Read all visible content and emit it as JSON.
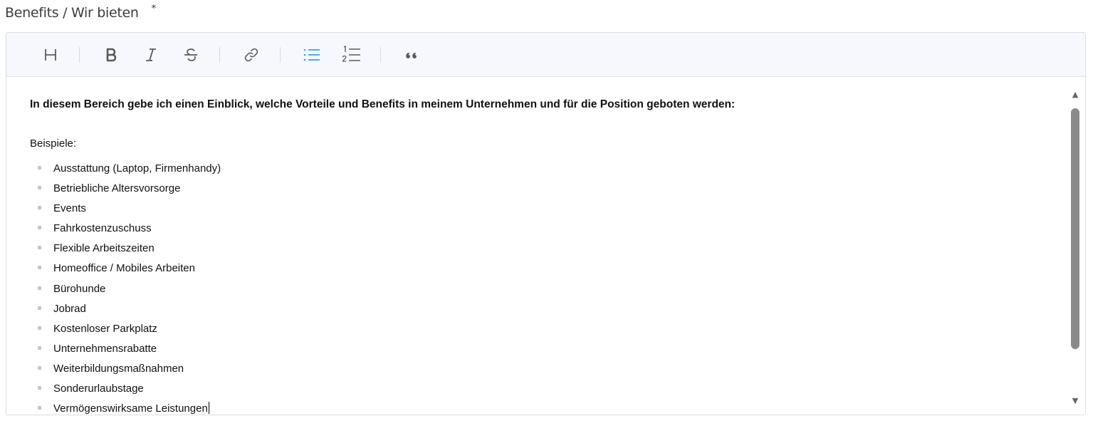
{
  "field": {
    "label": "Benefits / Wir bieten",
    "required_marker": "*"
  },
  "toolbar": {
    "buttons": [
      {
        "name": "heading",
        "icon": "heading-icon"
      },
      {
        "name": "bold",
        "icon": "bold-icon"
      },
      {
        "name": "italic",
        "icon": "italic-icon"
      },
      {
        "name": "strikethrough",
        "icon": "strikethrough-icon"
      },
      {
        "name": "link",
        "icon": "link-icon"
      },
      {
        "name": "bullet-list",
        "icon": "bullet-list-icon",
        "active": true
      },
      {
        "name": "numbered-list",
        "icon": "numbered-list-icon"
      },
      {
        "name": "quote",
        "icon": "quote-icon"
      }
    ],
    "active_color": "#2ea6e6"
  },
  "editor": {
    "intro": "In diesem Bereich gebe ich einen Einblick, welche Vorteile und Benefits in meinem Unternehmen und für die Position geboten werden:",
    "examples_label": "Beispiele:",
    "items": [
      "Ausstattung (Laptop, Firmenhandy)",
      "Betriebliche Altersvorsorge",
      "Events",
      "Fahrkostenzuschuss",
      "Flexible Arbeitszeiten",
      "Homeoffice / Mobiles Arbeiten",
      "Bürohunde",
      "Jobrad",
      "Kostenloser Parkplatz",
      "Unternehmensrabatte",
      "Weiterbildungsmaßnahmen",
      "Sonderurlaubstage",
      "Vermögenswirksame Leistungen"
    ]
  }
}
